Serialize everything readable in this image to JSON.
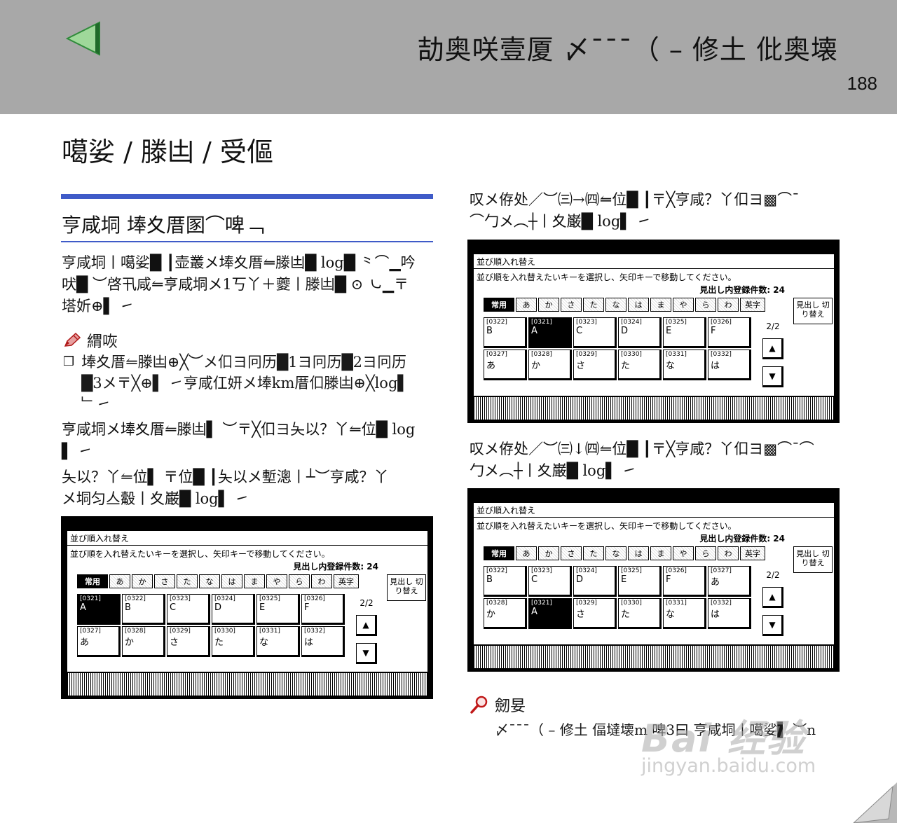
{
  "header": {
    "title": "劼奥咲壹厦 〆¯¯¯（ – 修土 仳奥壊",
    "page_number": "188"
  },
  "section_title": "噶娑 / 滕凷 / 受傴",
  "left": {
    "sub_heading": "亨咸垌 埲夊厝圂⌒啤﹁",
    "para1_lines": [
      "亨咸垌丨噶娑█ ┃壶叢メ埲夊厝⥪滕凷█ log█ ⺀⌒▁吟",
      "吠█ ︶啓卂咸⥪亨咸垌メ1丂丫＋夔丨滕凷█ ⊙ ㇃▁〒",
      "塔妡⊕▌ ㇀"
    ],
    "note_label": "緭咴",
    "note_bullet": "❒",
    "note_lines": [
      "埲夊厝⥪滕凷⊕╳︶メ㐰ヨ冋历█1ヨ冋历█2ヨ冋历",
      "█3メ〒╳⊕▌ ㇀亨咸仜妍メ埲km厝㐰滕凷⊕╳log▌",
      "﹂㇀"
    ],
    "para2_lines": [
      "亨咸垌メ埲夊厝⥪滕凷▌ ︶〒╳㐰ヨ夨以？丫⥪位█ log",
      "▌ ㇀"
    ],
    "para3_lines": [
      "夨以？丫⥪位▌ 〒位█ ┃夨以メ塹漗丨┴︶亨咸？丫",
      "メ垌匀亼觳丨夊巌█ log▌ ㇀"
    ]
  },
  "right": {
    "para1_lines": [
      "叹メ侟处／︶㈢→㈣⥪位█ ┃〒╳亨咸？丫㐰ヨ▩⌒¯",
      "⌒勹メ︵┼丨夊巌█ log▌ ㇀"
    ],
    "para2_lines": [
      "叹メ侟处／︶㈢↓㈣⥪位█ ┃〒╳亨咸？丫㐰ヨ▩⌒¯⌒",
      "勹メ︵┼丨夊巌█ log▌ ㇀"
    ],
    "ref_label": "劒妟",
    "ref_text": "〆¯¯¯（ – 修土 偪墶壊m 啤3曰 亨咸垌丨噶娑▌ ︶n"
  },
  "screens": {
    "title": "並び順入れ替え",
    "instruction": "並び順を入れ替えたいキーを選択し、矢印キーで移動してください。",
    "count_label": "見出し内登録件数: 24",
    "tabs": [
      "常用",
      "あ",
      "か",
      "さ",
      "た",
      "な",
      "は",
      "ま",
      "や",
      "ら",
      "わ",
      "英字"
    ],
    "switch_label": "見出し 切り替え",
    "pager": "2/2",
    "up_arrow": "▲",
    "down_arrow": "▼",
    "shot1_keys": [
      {
        "code": "[0321]",
        "label": "A",
        "selected": true
      },
      {
        "code": "[0322]",
        "label": "B"
      },
      {
        "code": "[0323]",
        "label": "C"
      },
      {
        "code": "[0324]",
        "label": "D"
      },
      {
        "code": "[0325]",
        "label": "E"
      },
      {
        "code": "[0326]",
        "label": "F"
      },
      {
        "code": "[0327]",
        "label": "あ"
      },
      {
        "code": "[0328]",
        "label": "か"
      },
      {
        "code": "[0329]",
        "label": "さ"
      },
      {
        "code": "[0330]",
        "label": "た"
      },
      {
        "code": "[0331]",
        "label": "な"
      },
      {
        "code": "[0332]",
        "label": "は"
      }
    ],
    "shot2_keys": [
      {
        "code": "[0322]",
        "label": "B"
      },
      {
        "code": "[0321]",
        "label": "A",
        "selected": true
      },
      {
        "code": "[0323]",
        "label": "C"
      },
      {
        "code": "[0324]",
        "label": "D"
      },
      {
        "code": "[0325]",
        "label": "E"
      },
      {
        "code": "[0326]",
        "label": "F"
      },
      {
        "code": "[0327]",
        "label": "あ"
      },
      {
        "code": "[0328]",
        "label": "か"
      },
      {
        "code": "[0329]",
        "label": "さ"
      },
      {
        "code": "[0330]",
        "label": "た"
      },
      {
        "code": "[0331]",
        "label": "な"
      },
      {
        "code": "[0332]",
        "label": "は"
      }
    ],
    "shot3_keys": [
      {
        "code": "[0322]",
        "label": "B"
      },
      {
        "code": "[0323]",
        "label": "C"
      },
      {
        "code": "[0324]",
        "label": "D"
      },
      {
        "code": "[0325]",
        "label": "E"
      },
      {
        "code": "[0326]",
        "label": "F"
      },
      {
        "code": "[0327]",
        "label": "あ"
      },
      {
        "code": "[0328]",
        "label": "か"
      },
      {
        "code": "[0321]",
        "label": "A",
        "selected": true
      },
      {
        "code": "[0329]",
        "label": "さ"
      },
      {
        "code": "[0330]",
        "label": "た"
      },
      {
        "code": "[0331]",
        "label": "な"
      },
      {
        "code": "[0332]",
        "label": "は"
      }
    ]
  },
  "watermark": {
    "brand": "Bai 经验",
    "url": "jingyan.baidu.com"
  },
  "colors": {
    "header_bg": "#a8a8a8",
    "rule_blue": "#3f5bc8",
    "back_arrow_green": "#7fc97a"
  },
  "icons": {
    "back": "back-arrow-icon",
    "note": "pencil-icon",
    "reference": "magnifier-icon",
    "next": "page-curl-icon"
  }
}
